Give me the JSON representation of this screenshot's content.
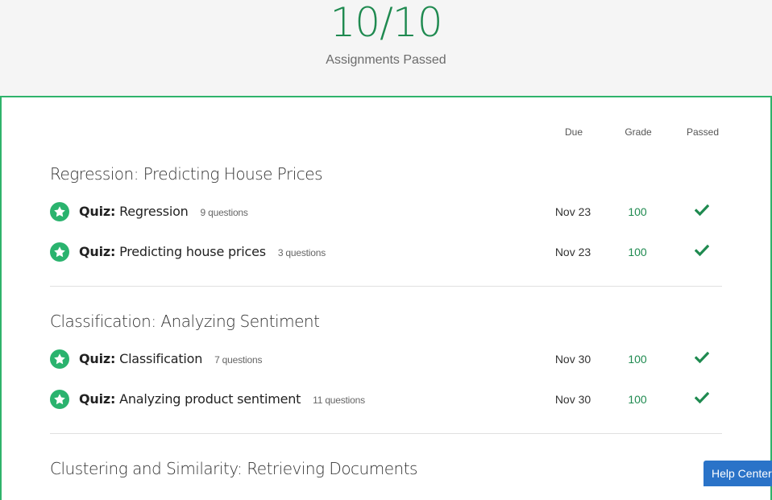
{
  "summary": {
    "score": "10/10",
    "label": "Assignments Passed"
  },
  "columns": {
    "due": "Due",
    "grade": "Grade",
    "passed": "Passed"
  },
  "sections": [
    {
      "title": "Regression: Predicting House Prices",
      "items": [
        {
          "type": "Quiz:",
          "name": "Regression",
          "count": "9 questions",
          "due": "Nov 23",
          "grade": "100",
          "passed": true
        },
        {
          "type": "Quiz:",
          "name": "Predicting house prices",
          "count": "3 questions",
          "due": "Nov 23",
          "grade": "100",
          "passed": true
        }
      ]
    },
    {
      "title": "Classification: Analyzing Sentiment",
      "items": [
        {
          "type": "Quiz:",
          "name": "Classification",
          "count": "7 questions",
          "due": "Nov 30",
          "grade": "100",
          "passed": true
        },
        {
          "type": "Quiz:",
          "name": "Analyzing product sentiment",
          "count": "11 questions",
          "due": "Nov 30",
          "grade": "100",
          "passed": true
        }
      ]
    },
    {
      "title": "Clustering and Similarity: Retrieving Documents",
      "items": []
    }
  ],
  "help": {
    "label": "Help Center"
  },
  "colors": {
    "accent": "#2fb36b",
    "score": "#1f8a50",
    "help": "#2a73c8"
  },
  "icons": {
    "item": "star-icon",
    "passed": "checkmark-icon"
  }
}
